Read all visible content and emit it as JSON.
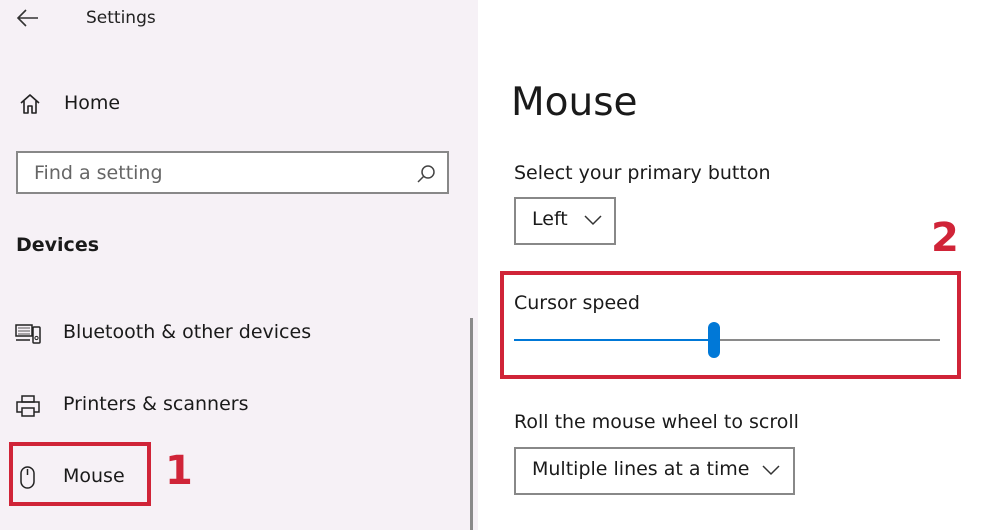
{
  "window": {
    "title": "Settings"
  },
  "sidebar": {
    "home_label": "Home",
    "search_placeholder": "Find a setting",
    "section_heading": "Devices",
    "items": [
      {
        "label": "Bluetooth & other devices",
        "icon": "bluetooth-devices-icon"
      },
      {
        "label": "Printers & scanners",
        "icon": "printer-icon"
      },
      {
        "label": "Mouse",
        "icon": "mouse-icon",
        "selected": true
      }
    ]
  },
  "main": {
    "page_title": "Mouse",
    "primary_button": {
      "label": "Select your primary button",
      "value": "Left"
    },
    "cursor_speed": {
      "label": "Cursor speed",
      "value_fraction": 0.47
    },
    "scroll_wheel": {
      "label": "Roll the mouse wheel to scroll",
      "value": "Multiple lines at a time"
    }
  },
  "annotations": {
    "marker_1": "1",
    "marker_2": "2",
    "highlight_color": "#d02438"
  },
  "colors": {
    "accent": "#0078d7",
    "sidebar_bg": "#f6f1f6"
  }
}
